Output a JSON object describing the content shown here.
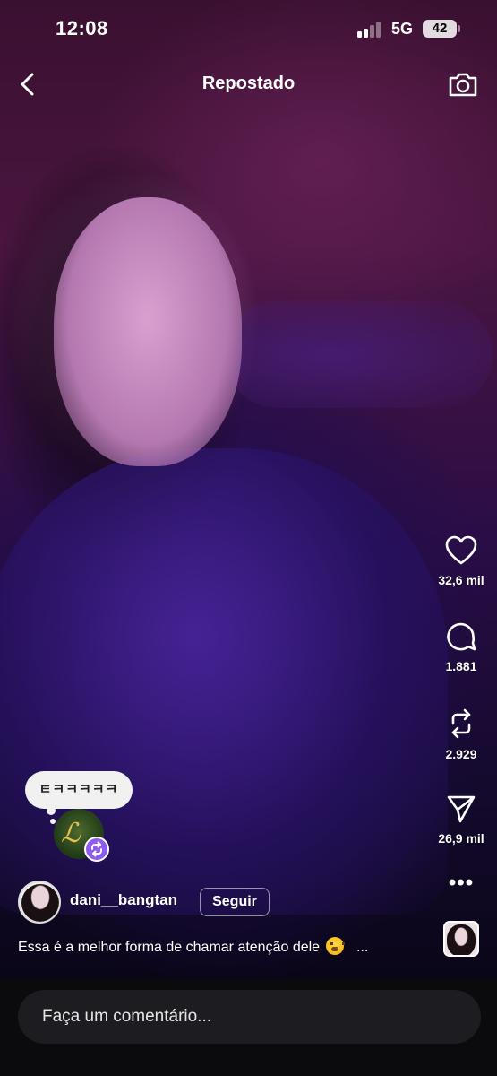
{
  "status_bar": {
    "time": "12:08",
    "network": "5G",
    "battery": "42"
  },
  "header": {
    "title": "Repostado",
    "back_icon": "chevron-left-icon",
    "camera_icon": "camera-icon"
  },
  "actions": [
    {
      "icon": "heart-icon",
      "count": "32,6 mil"
    },
    {
      "icon": "comment-icon",
      "count": "1.881"
    },
    {
      "icon": "repost-icon",
      "count": "2.929"
    },
    {
      "icon": "send-icon",
      "count": "26,9 mil"
    }
  ],
  "more_label": "•••",
  "repost_note": {
    "text": "ㅌㅋㅋㅋㅋㅋ"
  },
  "post": {
    "username": "dani__bangtan",
    "follow_label": "Seguir",
    "caption": "Essa é a melhor forma de chamar atenção dele",
    "caption_more": "...",
    "caption_emoji": "face-with-hand-over-mouth-emoji"
  },
  "comment": {
    "placeholder": "Faça um comentário..."
  },
  "colors": {
    "bottom_bar": "#0b0b0d",
    "input_bg": "#1d1d21",
    "repost_badge": "#8e5cf0"
  }
}
